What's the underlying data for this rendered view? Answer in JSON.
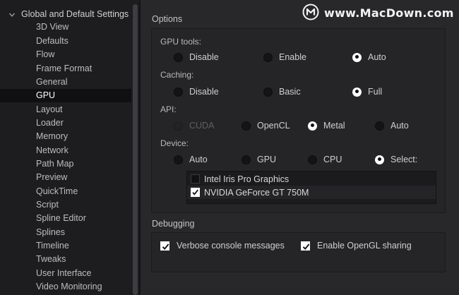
{
  "watermark": {
    "text": "www.MacDown.com"
  },
  "sidebar": {
    "parent_label": "Global and Default Settings",
    "items": [
      {
        "label": "3D View"
      },
      {
        "label": "Defaults"
      },
      {
        "label": "Flow"
      },
      {
        "label": "Frame Format"
      },
      {
        "label": "General"
      },
      {
        "label": "GPU",
        "selected": true
      },
      {
        "label": "Layout"
      },
      {
        "label": "Loader"
      },
      {
        "label": "Memory"
      },
      {
        "label": "Network"
      },
      {
        "label": "Path Map"
      },
      {
        "label": "Preview"
      },
      {
        "label": "QuickTime"
      },
      {
        "label": "Script"
      },
      {
        "label": "Spline Editor"
      },
      {
        "label": "Splines"
      },
      {
        "label": "Timeline"
      },
      {
        "label": "Tweaks"
      },
      {
        "label": "User Interface"
      },
      {
        "label": "Video Monitoring"
      }
    ]
  },
  "options": {
    "title": "Options",
    "gpu_tools": {
      "label": "GPU tools:",
      "options": [
        "Disable",
        "Enable",
        "Auto"
      ],
      "selected": "Auto"
    },
    "caching": {
      "label": "Caching:",
      "options": [
        "Disable",
        "Basic",
        "Full"
      ],
      "selected": "Full"
    },
    "api": {
      "label": "API:",
      "options": [
        "CUDA",
        "OpenCL",
        "Metal",
        "Auto"
      ],
      "selected": "Metal",
      "disabled": [
        "CUDA"
      ]
    },
    "device": {
      "label": "Device:",
      "options": [
        "Auto",
        "GPU",
        "CPU",
        "Select:"
      ],
      "selected": "Select:",
      "list": [
        {
          "name": "Intel Iris Pro Graphics",
          "checked": false
        },
        {
          "name": "NVIDIA GeForce GT 750M",
          "checked": true
        }
      ]
    }
  },
  "debugging": {
    "title": "Debugging",
    "verbose": {
      "label": "Verbose console messages",
      "checked": true
    },
    "opengl": {
      "label": "Enable OpenGL sharing",
      "checked": true
    }
  }
}
